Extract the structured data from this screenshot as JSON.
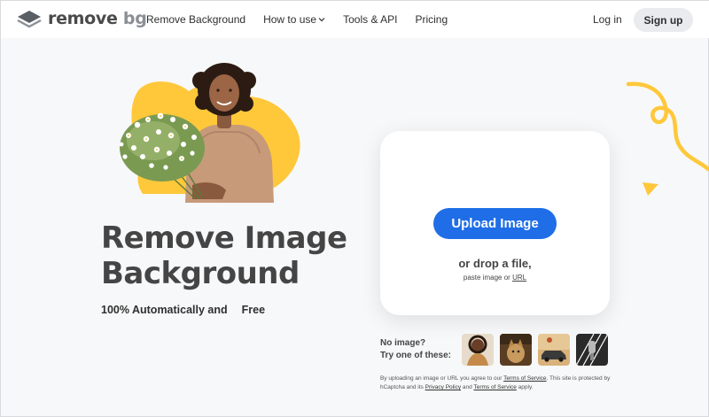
{
  "header": {
    "logo": {
      "word1": "remove",
      "word2": "bg"
    },
    "nav": [
      {
        "label": "Remove Background",
        "dropdown": false
      },
      {
        "label": "How to use",
        "dropdown": true
      },
      {
        "label": "Tools & API",
        "dropdown": false
      },
      {
        "label": "Pricing",
        "dropdown": false
      }
    ],
    "login_label": "Log in",
    "signup_label": "Sign up"
  },
  "hero": {
    "headline_line1": "Remove Image",
    "headline_line2": "Background",
    "subline": "100% Automatically and",
    "free_badge": "Free"
  },
  "upload": {
    "button_label": "Upload Image",
    "drop_text": "or drop a file,",
    "paste_text": "paste image or",
    "url_link": "URL"
  },
  "samples": {
    "prompt_line1": "No image?",
    "prompt_line2": "Try one of these:",
    "thumbnails": [
      {
        "name": "person-sample"
      },
      {
        "name": "animal-sample"
      },
      {
        "name": "car-sample"
      },
      {
        "name": "product-sample"
      }
    ]
  },
  "legal": {
    "text1": "By uploading an image or URL you agree to our",
    "tos": "Terms of Service",
    "text2": ". This site is protected by hCaptcha and its",
    "privacy": "Privacy Policy",
    "text3": "and",
    "tos2": "Terms of Service",
    "text4": "apply."
  },
  "colors": {
    "accent_blue": "#1f6ee8",
    "accent_yellow": "#ffc83a",
    "text_dark": "#454545"
  }
}
